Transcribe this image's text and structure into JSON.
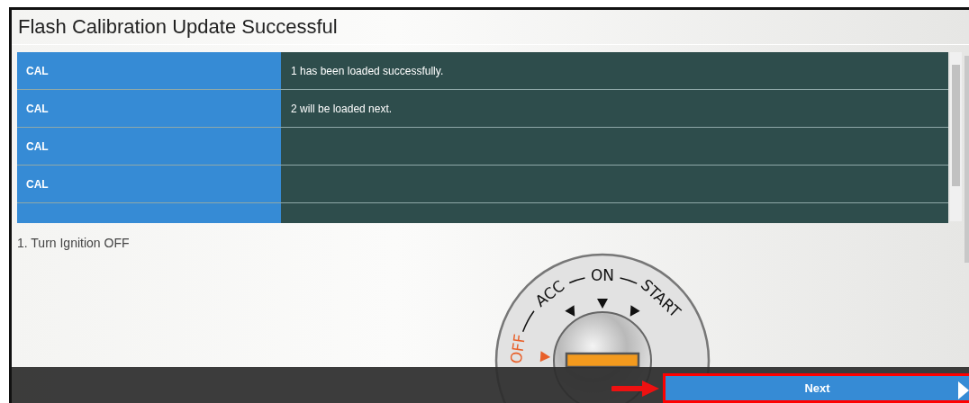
{
  "window": {
    "title": "Flash Calibration Update Successful"
  },
  "table": {
    "rows": [
      {
        "label": "CAL",
        "message": "1 has been loaded successfully."
      },
      {
        "label": "CAL",
        "message": "2 will be loaded next."
      },
      {
        "label": "CAL"
      },
      {
        "label": "CAL"
      },
      {}
    ]
  },
  "instruction": "1. Turn Ignition OFF",
  "ignition": {
    "positions": [
      {
        "label": "OFF",
        "selected": true
      },
      {
        "label": "ACC",
        "selected": false
      },
      {
        "label": "ON",
        "selected": false
      },
      {
        "label": "START",
        "selected": false
      }
    ]
  },
  "buttons": [
    {
      "label": "Next"
    }
  ]
}
